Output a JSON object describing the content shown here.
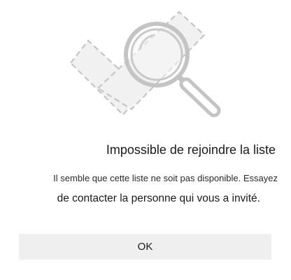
{
  "dialog": {
    "title": "Impossible de rejoindre la liste",
    "message_line1": "Il semble que cette liste ne soit pas disponible. Essayez",
    "message_line2": "de contacter la personne qui vous a invité.",
    "ok_label": "OK"
  },
  "illustration": {
    "icon": "magnifier-over-missing-list-icon",
    "colors": {
      "stroke": "#c4c4c4",
      "fill": "#f1f1f1"
    }
  }
}
